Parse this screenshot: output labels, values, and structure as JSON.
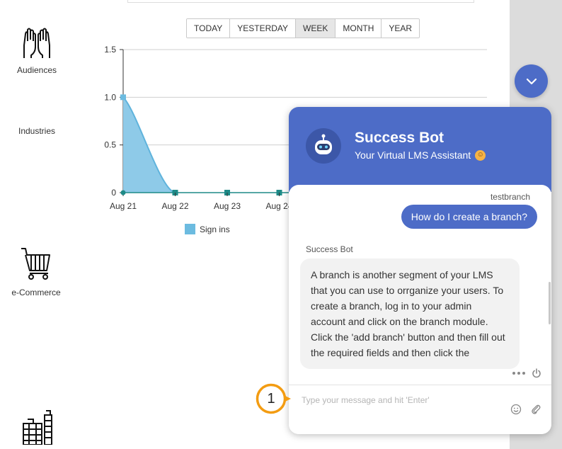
{
  "nav": {
    "audiences": "Audiences",
    "industries": "Industries",
    "ecommerce": "e-Commerce"
  },
  "range": {
    "buttons": [
      "TODAY",
      "YESTERDAY",
      "WEEK",
      "MONTH",
      "YEAR"
    ],
    "active": "WEEK"
  },
  "chart_data": {
    "type": "area",
    "categories": [
      "Aug 21",
      "Aug 22",
      "Aug 23",
      "Aug 24"
    ],
    "series": [
      {
        "name": "Sign ins",
        "values": [
          1,
          0,
          0,
          0
        ],
        "color": "#6cbbe0"
      }
    ],
    "y_ticks": [
      "0",
      "0.5",
      "1.0",
      "1.5"
    ],
    "ylim": [
      0,
      1.5
    ],
    "grid": true,
    "legend": "bottom"
  },
  "chat": {
    "title": "Success Bot",
    "subtitle": "Your Virtual LMS Assistant",
    "subtitle_emoji": "smiling-face-icon",
    "user_name": "testbranch",
    "user_message": "How do I create a branch?",
    "bot_label": "Success Bot",
    "bot_message": "A branch is another segment of your LMS that you can use to orrganize your users. To create a branch, log in to your admin account and click on the branch module. Click the 'add branch' button and then fill out the required fields and then click the",
    "input_placeholder": "Type your message and hit 'Enter'",
    "accent": "#4d6cc7"
  },
  "callout": {
    "number": "1",
    "color": "#f39c12"
  }
}
